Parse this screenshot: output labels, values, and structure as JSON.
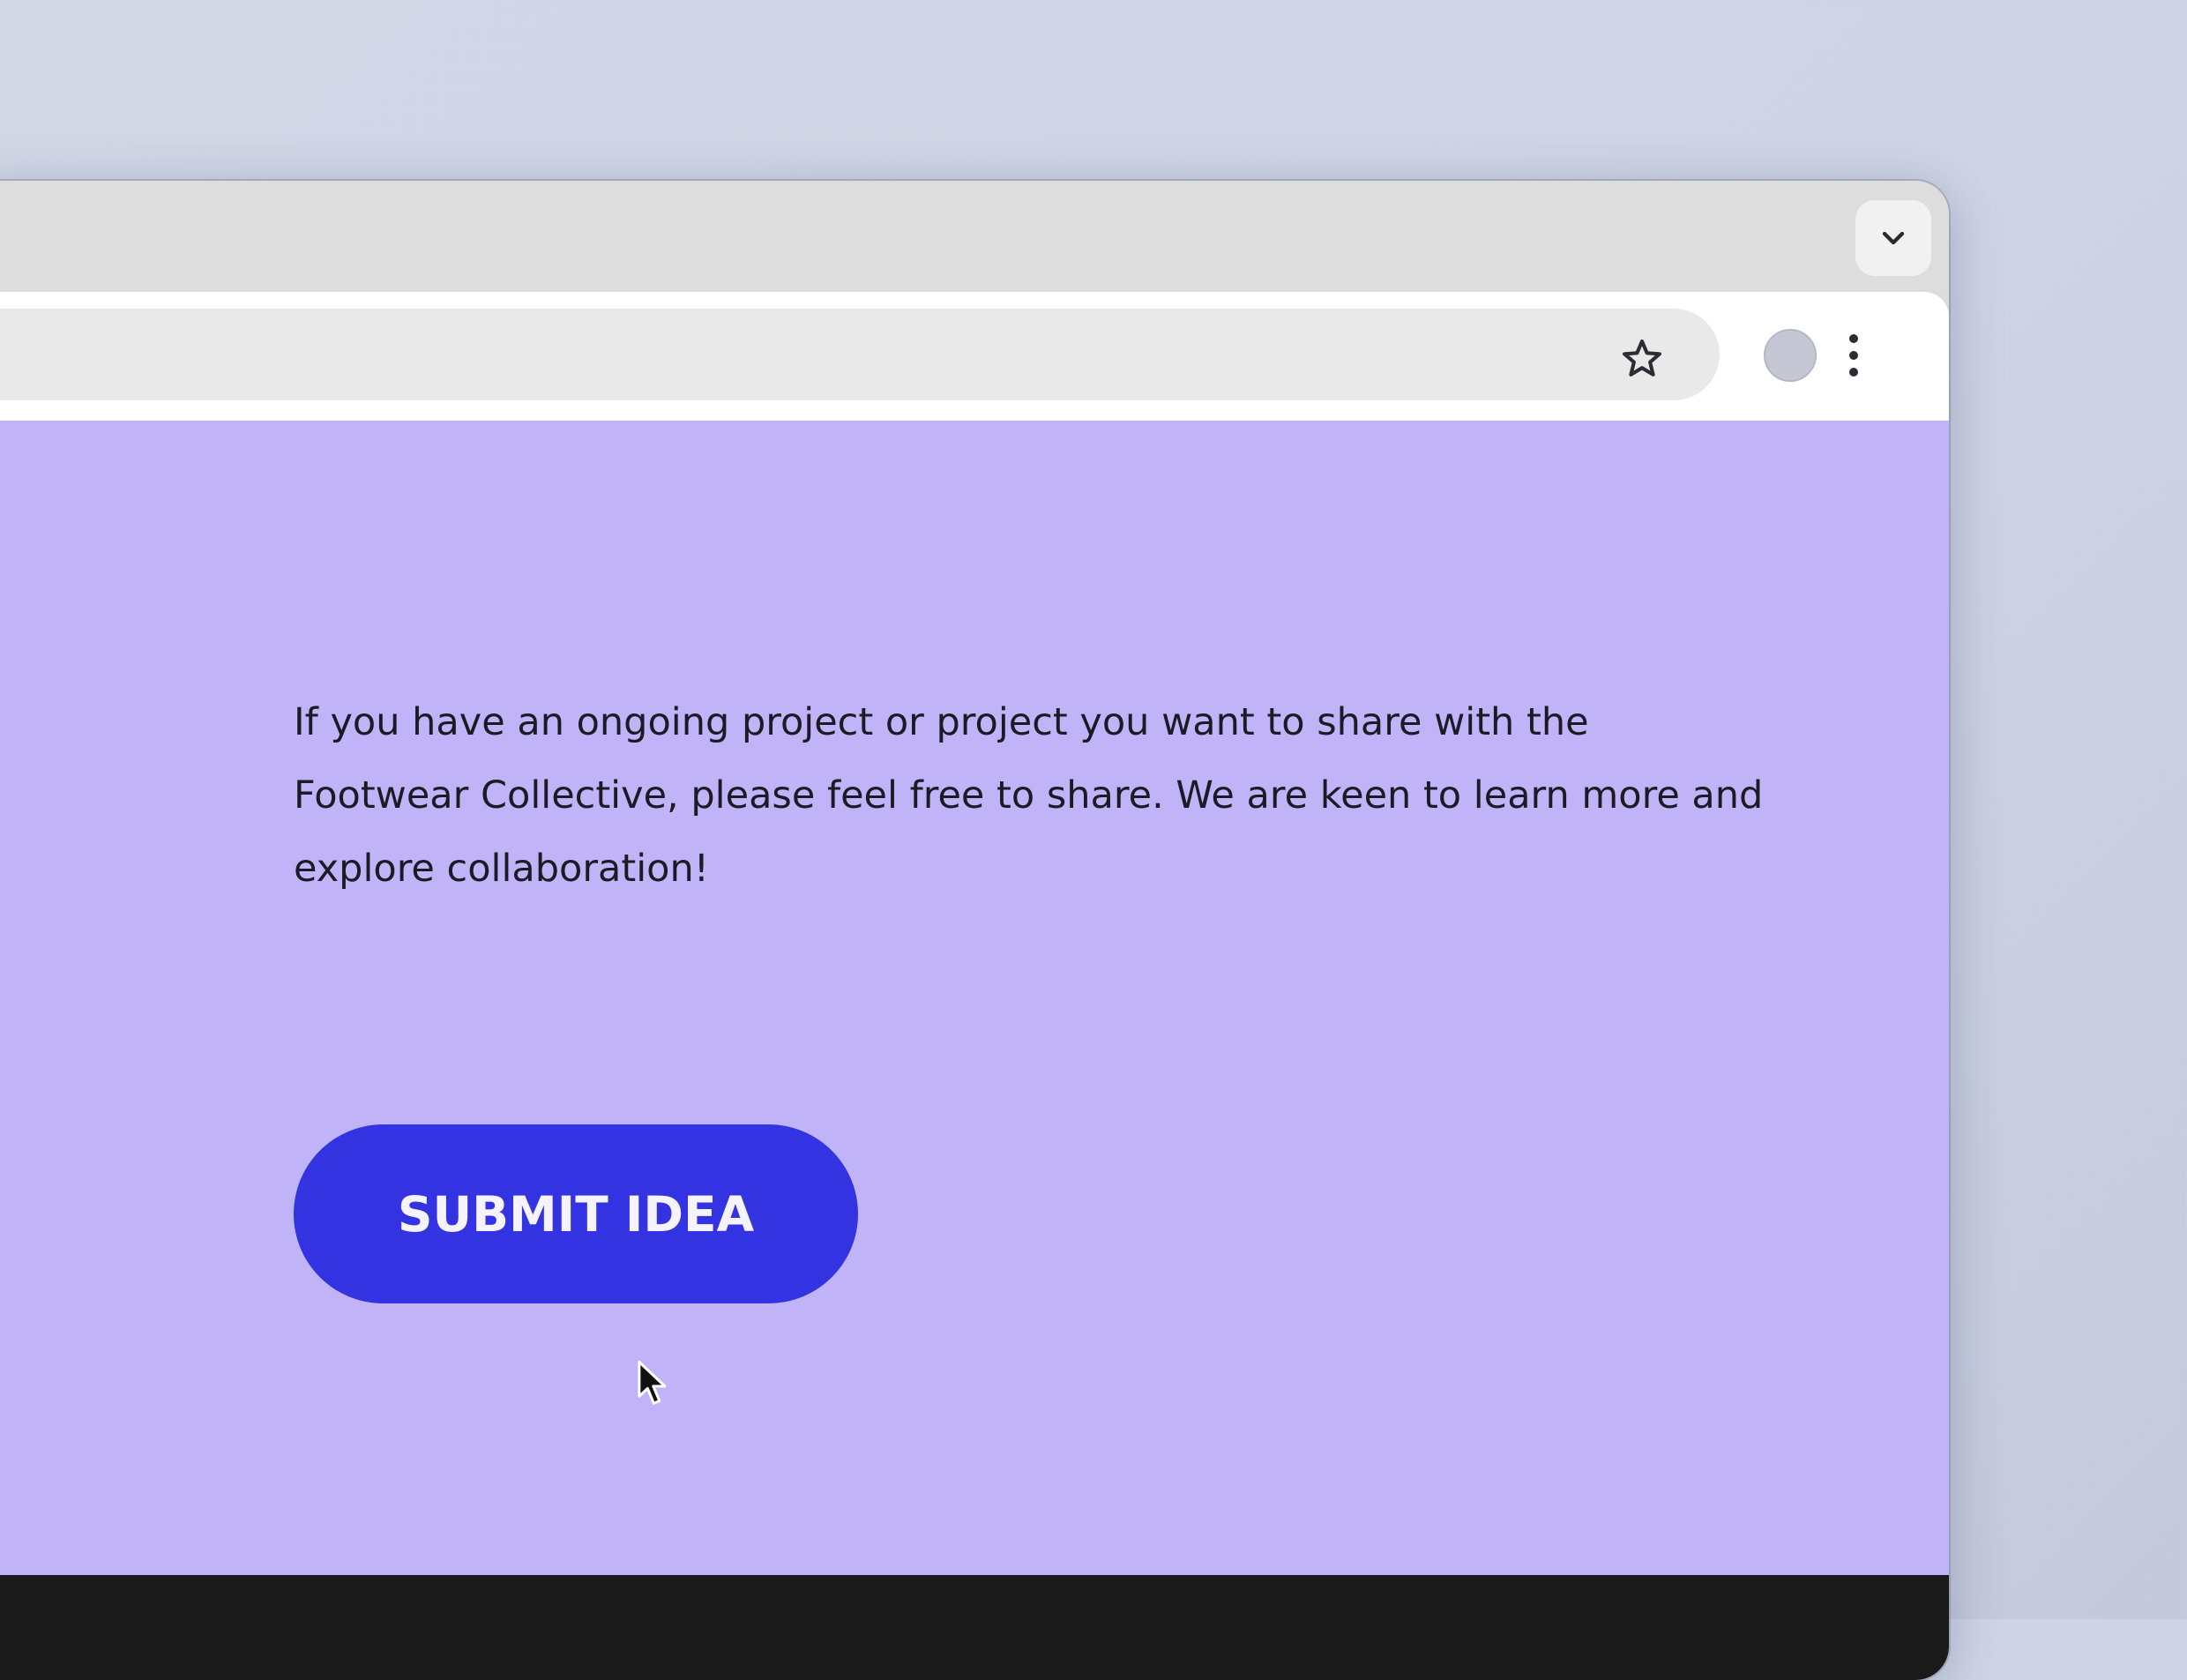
{
  "browser": {
    "tab_search_icon": "chevron-down-icon",
    "bookmark_icon": "star-outline-icon",
    "profile_icon": "avatar-circle",
    "menu_icon": "three-dots-vertical-icon"
  },
  "page": {
    "intro_text": "If you have an ongoing project or project you want to share with the Footwear Collective, please feel free to share. We are keen to learn more and explore collaboration!",
    "submit_label": "SUBMIT IDEA"
  },
  "colors": {
    "page_background": "#c0b3f8",
    "button_background": "#3333e2",
    "button_text": "#f5f3ff",
    "footer": "#1a1a1a",
    "body_text": "#1b1b25"
  },
  "cursor": {
    "icon": "arrow-pointer-icon"
  }
}
